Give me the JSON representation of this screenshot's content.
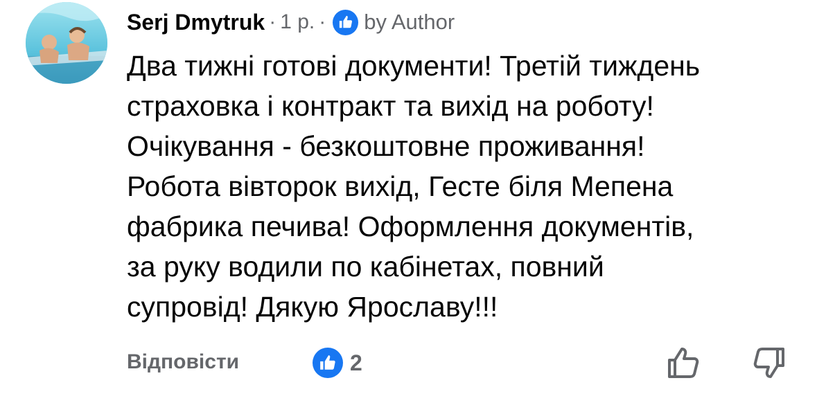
{
  "comment": {
    "author": "Serj Dmytruk",
    "separator": "·",
    "time": "1 р.",
    "author_badge": "by Author",
    "lines": [
      "Два тижні готові документи! Третій тиждень",
      "страховка і контракт та вихід на роботу!",
      "Очікування - безкоштовне проживання!",
      "Робота вівторок вихід, Гесте біля Мепена",
      "фабрика печива! Оформлення документів,",
      "за руку водили по кабінетах, повний",
      "супровід! Дякую Ярославу!!!"
    ]
  },
  "footer": {
    "reply_label": "Відповісти",
    "reaction_count": "2",
    "reaction_icon": "thumbs-up-icon",
    "upvote_icon": "thumbs-up-outline-icon",
    "downvote_icon": "thumbs-down-outline-icon"
  },
  "colors": {
    "accent": "#1877f2",
    "secondary_text": "#65676b",
    "primary_text": "#050505"
  }
}
